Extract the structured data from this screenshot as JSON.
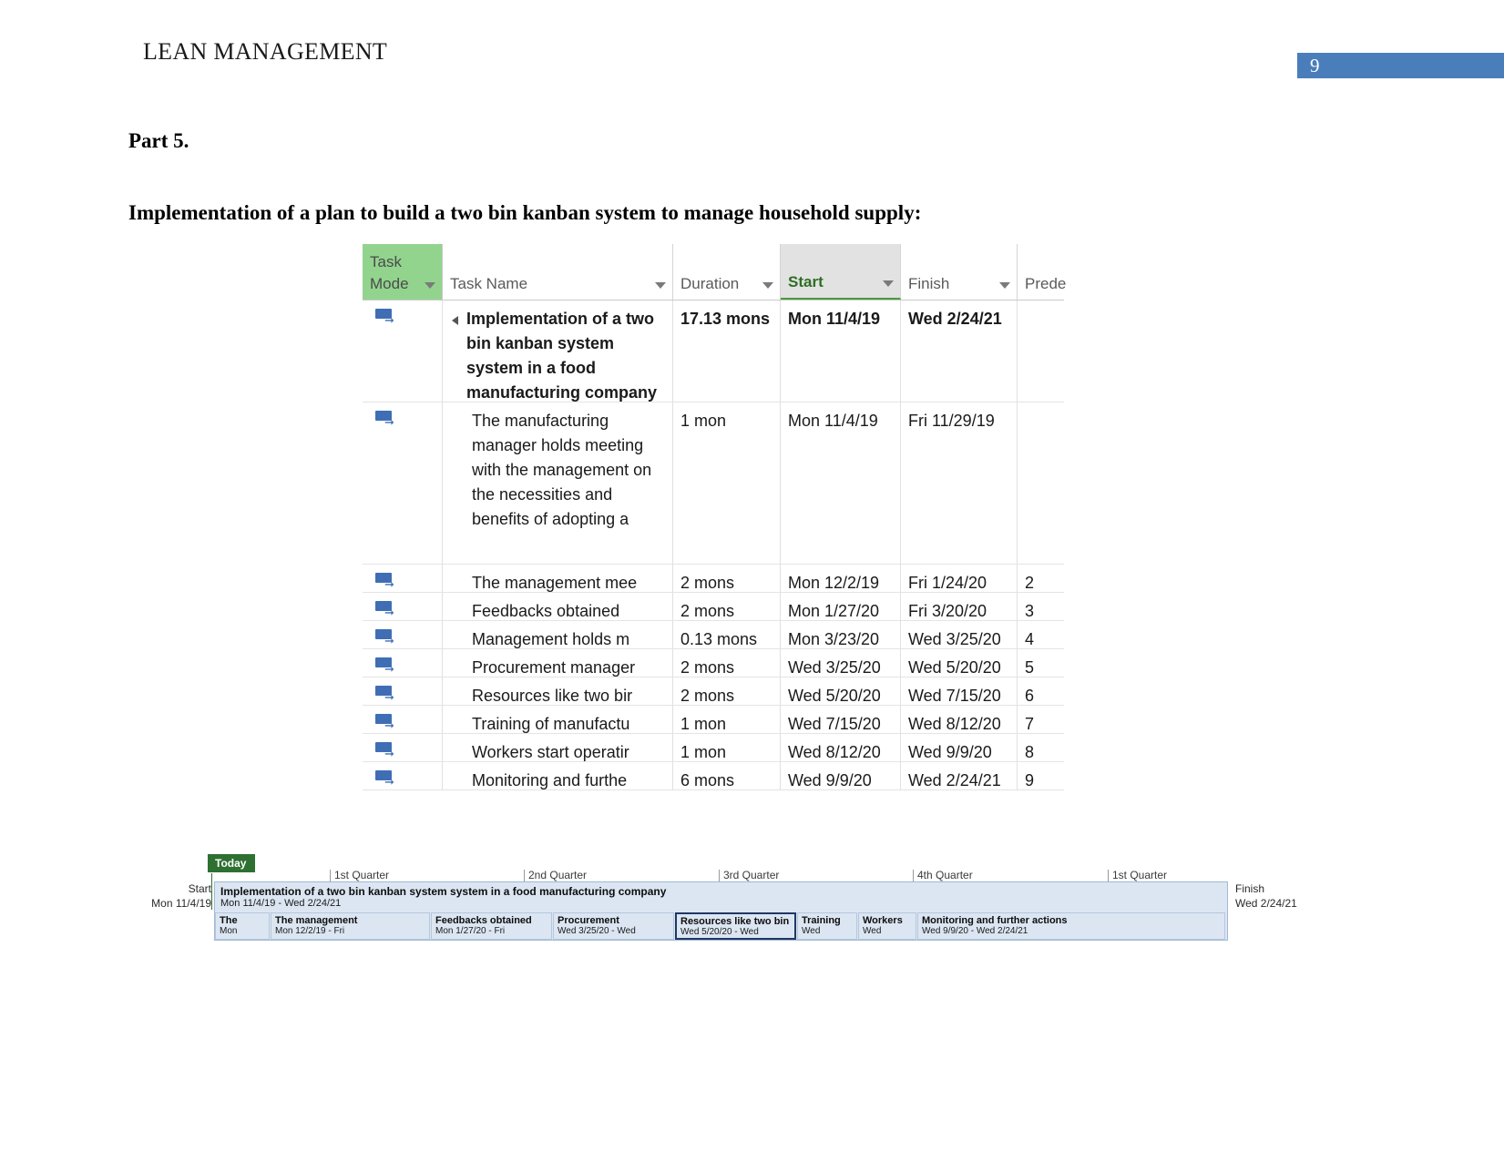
{
  "header": {
    "title": "LEAN MANAGEMENT",
    "page_number": "9",
    "badge_color": "#4a7ebb"
  },
  "body": {
    "part_heading": "Part 5.",
    "sub_heading": "Implementation of a plan to build a two bin kanban system to manage household supply:"
  },
  "project_table": {
    "columns": [
      {
        "key": "task_mode",
        "label_line1": "Task",
        "label_line2": "Mode",
        "highlight": "#92d48e"
      },
      {
        "key": "task_name",
        "label": "Task Name"
      },
      {
        "key": "duration",
        "label": "Duration"
      },
      {
        "key": "start",
        "label": "Start",
        "selected": true,
        "accent": "#2f6e24"
      },
      {
        "key": "finish",
        "label": "Finish"
      },
      {
        "key": "predecessors",
        "label": "Prede"
      }
    ],
    "rows": [
      {
        "mode_icon": "auto-schedule-icon",
        "summary": true,
        "collapse": true,
        "name": "Implementation of a two bin kanban system system in a food manufacturing company",
        "duration": "17.13 mons",
        "start": "Mon 11/4/19",
        "finish": "Wed 2/24/21",
        "predecessors": ""
      },
      {
        "mode_icon": "auto-schedule-icon",
        "summary": false,
        "name": "The manufacturing manager holds meeting with the management on the necessities and benefits of adopting a",
        "duration": "1 mon",
        "start": "Mon 11/4/19",
        "finish": "Fri 11/29/19",
        "predecessors": ""
      },
      {
        "mode_icon": "auto-schedule-icon",
        "summary": false,
        "name": "The management mee",
        "duration": "2 mons",
        "start": "Mon 12/2/19",
        "finish": "Fri 1/24/20",
        "predecessors": "2"
      },
      {
        "mode_icon": "auto-schedule-icon",
        "summary": false,
        "name": "Feedbacks obtained",
        "duration": "2 mons",
        "start": "Mon 1/27/20",
        "finish": "Fri 3/20/20",
        "predecessors": "3"
      },
      {
        "mode_icon": "auto-schedule-icon",
        "summary": false,
        "name": "Management holds m",
        "duration": "0.13 mons",
        "start": "Mon 3/23/20",
        "finish": "Wed 3/25/20",
        "predecessors": "4"
      },
      {
        "mode_icon": "auto-schedule-icon",
        "summary": false,
        "name": "Procurement manager",
        "duration": "2 mons",
        "start": "Wed 3/25/20",
        "finish": "Wed 5/20/20",
        "predecessors": "5"
      },
      {
        "mode_icon": "auto-schedule-icon",
        "summary": false,
        "name": "Resources like two bir",
        "duration": "2 mons",
        "start": "Wed 5/20/20",
        "finish": "Wed 7/15/20",
        "predecessors": "6"
      },
      {
        "mode_icon": "auto-schedule-icon",
        "summary": false,
        "name": "Training of manufactu",
        "duration": "1 mon",
        "start": "Wed 7/15/20",
        "finish": "Wed 8/12/20",
        "predecessors": "7"
      },
      {
        "mode_icon": "auto-schedule-icon",
        "summary": false,
        "name": "Workers start operatir",
        "duration": "1 mon",
        "start": "Wed 8/12/20",
        "finish": "Wed 9/9/20",
        "predecessors": "8"
      },
      {
        "mode_icon": "auto-schedule-icon",
        "summary": false,
        "name": "Monitoring and furthe",
        "duration": "6 mons",
        "start": "Wed 9/9/20",
        "finish": "Wed 2/24/21",
        "predecessors": "9"
      }
    ]
  },
  "timeline": {
    "today_label": "Today",
    "quarters": [
      "1st Quarter",
      "2nd Quarter",
      "3rd Quarter",
      "4th Quarter",
      "1st Quarter"
    ],
    "start_label": "Start",
    "start_date": "Mon 11/4/19",
    "finish_label": "Finish",
    "finish_date": "Wed 2/24/21",
    "summary_bar": {
      "name": "Implementation of a two bin kanban system system in a food manufacturing company",
      "dates": "Mon 11/4/19 - Wed 2/24/21"
    },
    "tasks": [
      {
        "name": "The",
        "dates": "Mon",
        "highlight": false
      },
      {
        "name": "The management",
        "dates": "Mon 12/2/19 - Fri",
        "highlight": false
      },
      {
        "name": "Feedbacks obtained",
        "dates": "Mon 1/27/20 - Fri",
        "highlight": false
      },
      {
        "name": "Procurement",
        "dates": "Wed 3/25/20 - Wed",
        "highlight": false
      },
      {
        "name": "Resources like two bin",
        "dates": "Wed 5/20/20 - Wed",
        "highlight": true
      },
      {
        "name": "Training",
        "dates": "Wed",
        "highlight": false
      },
      {
        "name": "Workers",
        "dates": "Wed",
        "highlight": false
      },
      {
        "name": "Monitoring and further actions",
        "dates": "Wed 9/9/20 - Wed 2/24/21",
        "highlight": false
      }
    ]
  }
}
